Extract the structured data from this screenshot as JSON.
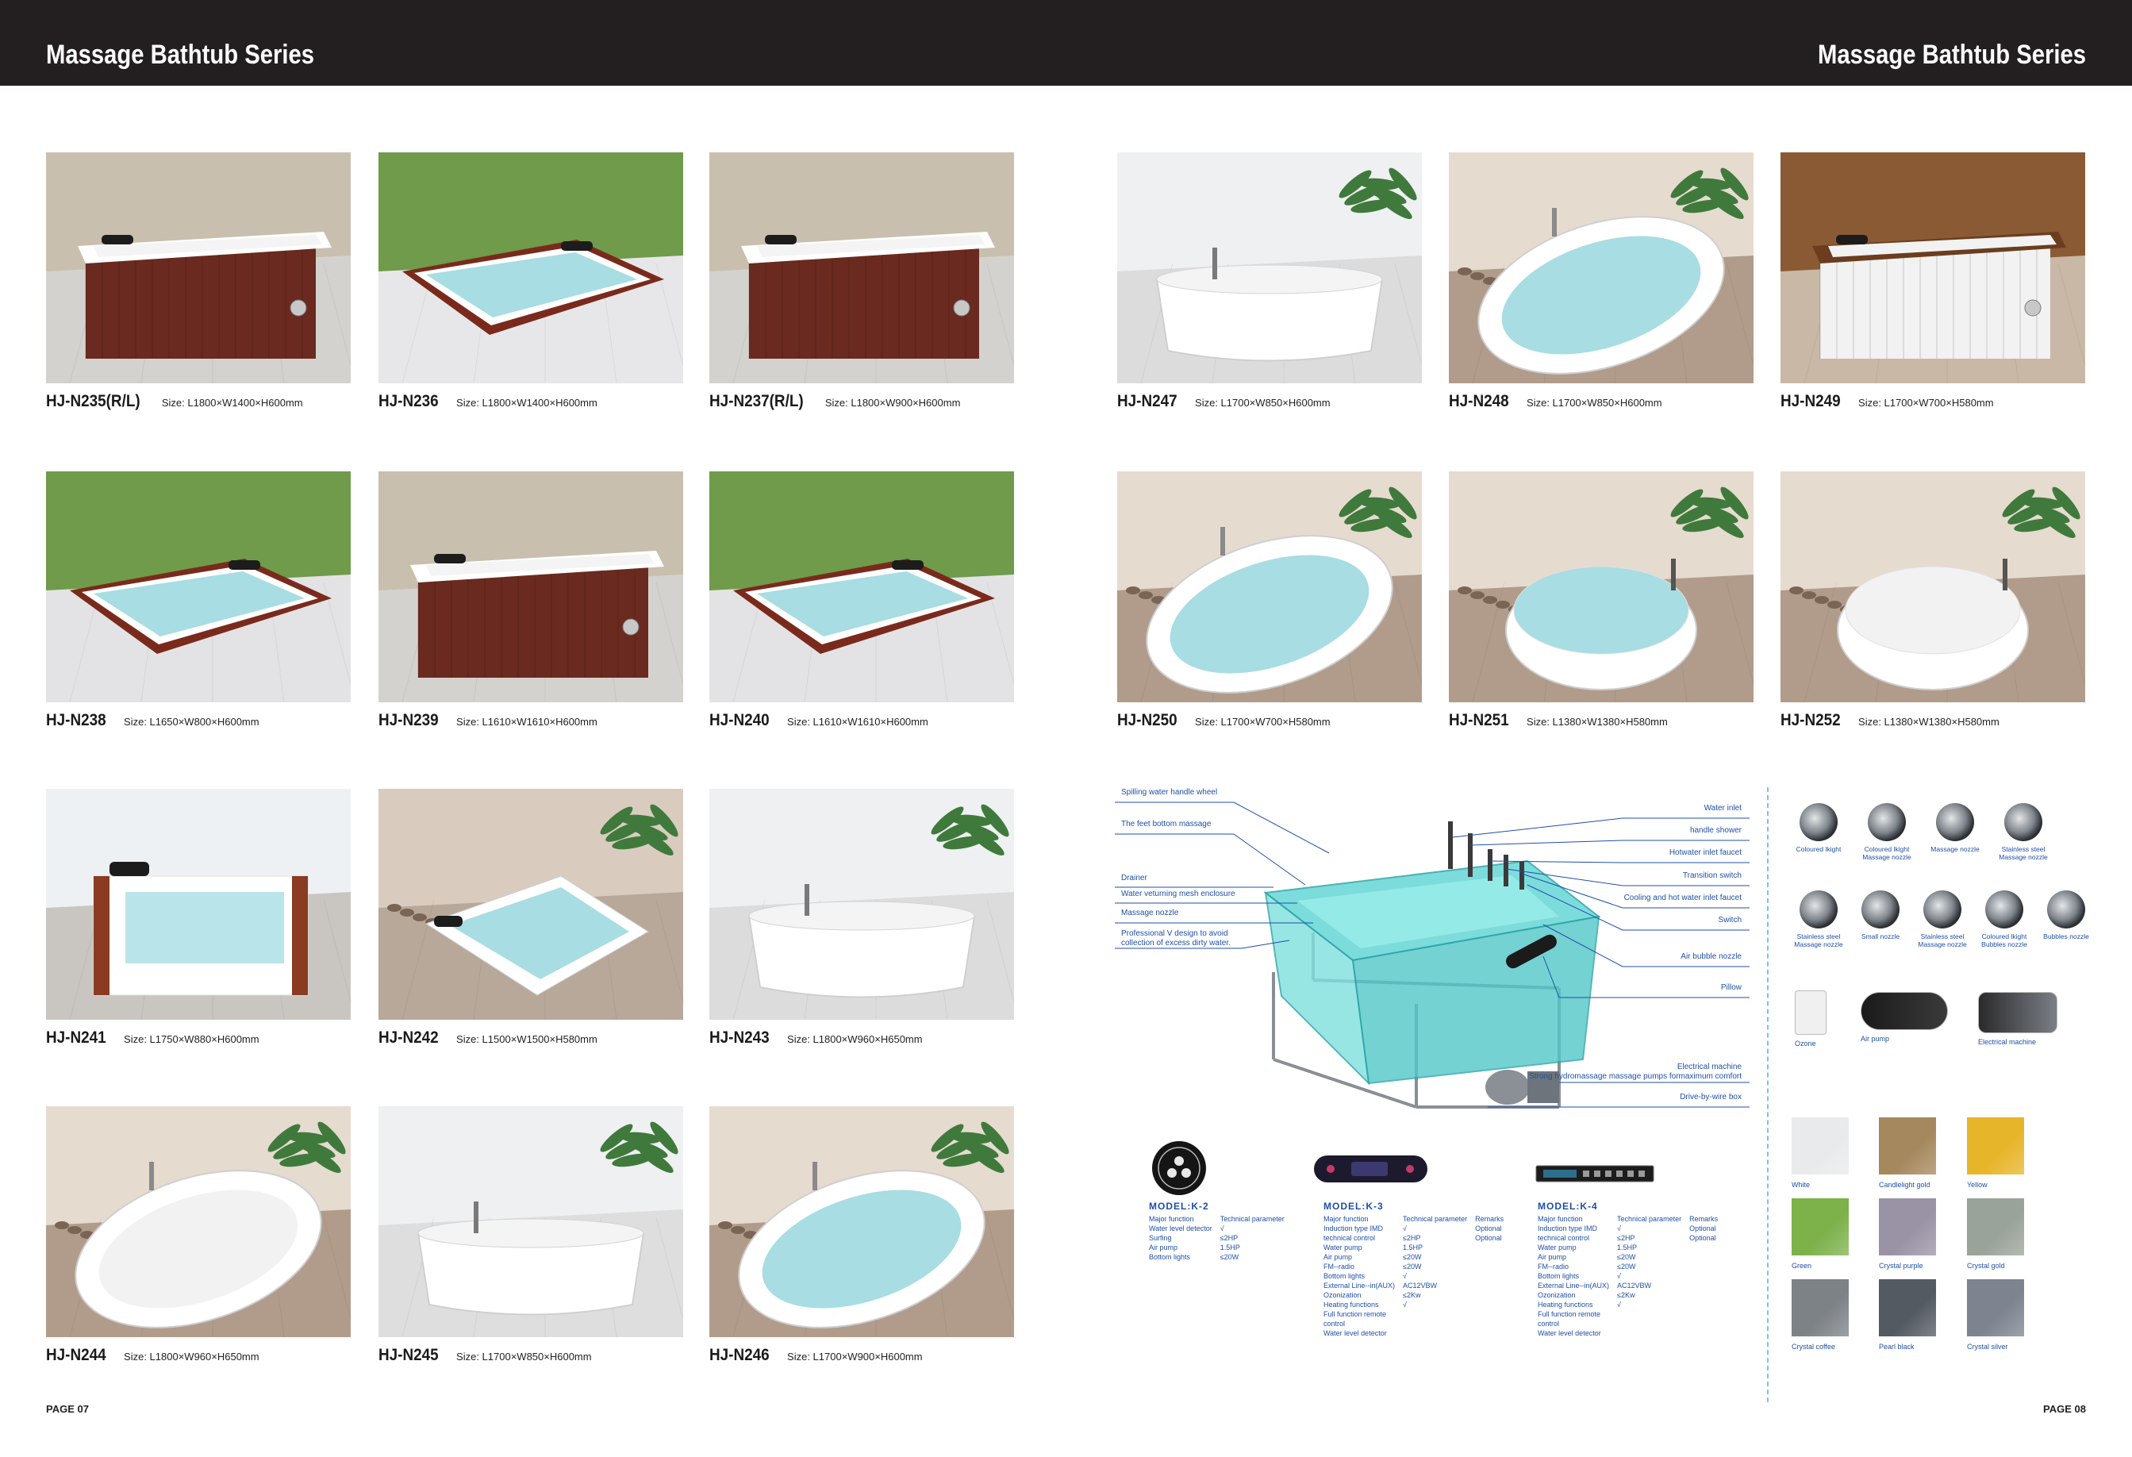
{
  "header": {
    "left_title": "Massage Bathtub Series",
    "right_title": "Massage Bathtub Series"
  },
  "size_prefix": "Size:",
  "products": [
    {
      "code": "HJ-N235(R/L)",
      "size": "Size: L1800×W1400×H600mm",
      "wall": "#c9bfae",
      "floor": "#d4d2cf",
      "tub_color": "#6b2a1f",
      "rim": "#ffffff",
      "water": "#f4f4f4",
      "style": "box"
    },
    {
      "code": "HJ-N236",
      "size": "Size: L1800×W1400×H600mm",
      "wall": "#6f9b4a",
      "floor": "#e7e7e9",
      "tub_color": "#7a2a1c",
      "rim": "#ffffff",
      "water": "#a7dde3",
      "style": "sunken"
    },
    {
      "code": "HJ-N237(R/L)",
      "size": "Size: L1800×W900×H600mm",
      "wall": "#c9bfae",
      "floor": "#d4d2cf",
      "tub_color": "#6b2a1f",
      "rim": "#ffffff",
      "water": "#f4f4f4",
      "style": "box"
    },
    {
      "code": "HJ-N238",
      "size": "Size: L1650×W800×H600mm",
      "wall": "#6f9b4a",
      "floor": "#e3e3e5",
      "tub_color": "#7a2a1c",
      "rim": "#ffffff",
      "water": "#a7dde3",
      "style": "sunken"
    },
    {
      "code": "HJ-N239",
      "size": "Size: L1610×W1610×H600mm",
      "wall": "#c9bfae",
      "floor": "#d4d2cf",
      "tub_color": "#6b2a1f",
      "rim": "#ffffff",
      "water": "#f4f4f4",
      "style": "box"
    },
    {
      "code": "HJ-N240",
      "size": "Size: L1610×W1610×H600mm",
      "wall": "#6f9b4a",
      "floor": "#e3e3e5",
      "tub_color": "#7a2a1c",
      "rim": "#ffffff",
      "water": "#a7dde3",
      "style": "sunken"
    },
    {
      "code": "HJ-N241",
      "size": "Size: L1750×W880×H600mm",
      "wall": "#eef1f3",
      "floor": "#c9c6c2",
      "tub_color": "#ffffff",
      "rim": "#8a3b22",
      "water": "#a7dde3",
      "style": "glass"
    },
    {
      "code": "HJ-N242",
      "size": "Size: L1500×W1500×H580mm",
      "wall": "#d9ccbf",
      "floor": "#b8a89a",
      "tub_color": "#ffffff",
      "rim": "#ffffff",
      "water": "#a7dde3",
      "style": "corner"
    },
    {
      "code": "HJ-N243",
      "size": "Size: L1800×W960×H650mm",
      "wall": "#eef0f1",
      "floor": "#dcdcdc",
      "tub_color": "#ffffff",
      "rim": "#ffffff",
      "water": "#ffffff",
      "style": "free"
    },
    {
      "code": "HJ-N244",
      "size": "Size: L1800×W960×H650mm",
      "wall": "#e6dbcf",
      "floor": "#b19c8b",
      "tub_color": "#ffffff",
      "rim": "#ffffff",
      "water": "#f2f2f2",
      "style": "oval"
    },
    {
      "code": "HJ-N245",
      "size": "Size: L1700×W850×H600mm",
      "wall": "#eef0f1",
      "floor": "#dedede",
      "tub_color": "#ffffff",
      "rim": "#ffffff",
      "water": "#ffffff",
      "style": "free"
    },
    {
      "code": "HJ-N246",
      "size": "Size: L1700×W900×H600mm",
      "wall": "#e6dbcf",
      "floor": "#b19c8b",
      "tub_color": "#ffffff",
      "rim": "#ffffff",
      "water": "#a7dde3",
      "style": "oval"
    },
    {
      "code": "HJ-N247",
      "size": "Size: L1700×W850×H600mm",
      "wall": "#eef0f1",
      "floor": "#dcdcdc",
      "tub_color": "#ffffff",
      "rim": "#ffffff",
      "water": "#ffffff",
      "style": "free"
    },
    {
      "code": "HJ-N248",
      "size": "Size: L1700×W850×H600mm",
      "wall": "#e6dbcf",
      "floor": "#b19c8b",
      "tub_color": "#ffffff",
      "rim": "#ffffff",
      "water": "#a7dde3",
      "style": "oval"
    },
    {
      "code": "HJ-N249",
      "size": "Size: L1700×W700×H580mm",
      "wall": "#8a5a35",
      "floor": "#c9b8a5",
      "tub_color": "#f2f2f2",
      "rim": "#6b3d1e",
      "water": "#f2f2f2",
      "style": "box"
    },
    {
      "code": "HJ-N250",
      "size": "Size: L1700×W700×H580mm",
      "wall": "#e6dbcf",
      "floor": "#b19c8b",
      "tub_color": "#ffffff",
      "rim": "#ffffff",
      "water": "#a7dde3",
      "style": "oval"
    },
    {
      "code": "HJ-N251",
      "size": "Size: L1380×W1380×H580mm",
      "wall": "#e6dbcf",
      "floor": "#b19c8b",
      "tub_color": "#ffffff",
      "rim": "#ffffff",
      "water": "#a7dde3",
      "style": "round"
    },
    {
      "code": "HJ-N252",
      "size": "Size: L1380×W1380×H580mm",
      "wall": "#e6dbcf",
      "floor": "#b19c8b",
      "tub_color": "#ffffff",
      "rim": "#ffffff",
      "water": "#f2f2f2",
      "style": "round"
    }
  ],
  "diagram": {
    "left_labels": [
      "Spilling water handle wheel",
      "The feet bottom massage",
      "Drainer",
      "Water veturning mesh enclosure",
      "Massage nozzle",
      "Professional V design to avoid",
      "collection of excess dirty water."
    ],
    "right_labels": [
      "Water inlet",
      "handle shower",
      "Hotwater inlet faucet",
      "Transition switch",
      "Cooling and hot water inlet faucet",
      "Switch",
      "Air bubble nozzle",
      "Pillow",
      "Electrical machine",
      "Strong hydromassage massage pumps formaximum comfort",
      "Drive-by-wire box"
    ]
  },
  "models": [
    {
      "title": "MODEL:K-2",
      "col1": [
        "Major function",
        "Water level detector",
        "Surfing",
        "Air pump",
        "Bottom lights"
      ],
      "col2": [
        "Technical parameter",
        "√",
        "≤2HP",
        "1.5HP",
        "≤20W"
      ],
      "col3": []
    },
    {
      "title": "MODEL:K-3",
      "col1": [
        "Major function",
        "Induction type IMD",
        "technical control",
        "Water pump",
        "Air pump",
        "FM--radio",
        "Bottom lights",
        "External Line--in(AUX)",
        "Ozonization",
        "Heating functions",
        "Full function remote",
        "control",
        "Water level detector"
      ],
      "col2": [
        "Technical parameter",
        "√",
        "≤2HP",
        "1.5HP",
        "≤20W",
        "≤20W",
        "√",
        "AC12VBW",
        "≤2Kw",
        "√"
      ],
      "col3": [
        "Remarks",
        "Optional",
        "Optional"
      ]
    },
    {
      "title": "MODEL:K-4",
      "col1": [
        "Major function",
        "Induction type IMD",
        "technical control",
        "Water pump",
        "Air pump",
        "FM--radio",
        "Bottom lights",
        "External Line--in(AUX)",
        "Ozonization",
        "Heating functions",
        "Full function remote",
        "control",
        "Water level detector"
      ],
      "col2": [
        "Technical parameter",
        "√",
        "≤2HP",
        "1.5HP",
        "≤20W",
        "≤20W",
        "√",
        "AC12VBW",
        "≤2Kw",
        "√"
      ],
      "col3": [
        "Remarks",
        "Optional",
        "Optional"
      ]
    }
  ],
  "parts_row1": [
    {
      "label": "Coloured lkight",
      "icon": "nozzle-icon"
    },
    {
      "label": "Coloured lkight Massage nozzle",
      "icon": "nozzle-icon"
    },
    {
      "label": "Massage nozzle",
      "icon": "nozzle-icon"
    },
    {
      "label": "Stainless steel Massage nozzle",
      "icon": "nozzle-icon"
    }
  ],
  "parts_row2": [
    {
      "label": "Stainless steel Massage nozzle",
      "icon": "nozzle-icon"
    },
    {
      "label": "Small nozzle",
      "icon": "nozzle-icon"
    },
    {
      "label": "Stainless steel Massage nozzle",
      "icon": "nozzle-icon"
    },
    {
      "label": "Coloured lkight Bubbles nozzle",
      "icon": "nozzle-icon"
    },
    {
      "label": "Bubbles nozzle",
      "icon": "nozzle-icon"
    }
  ],
  "equipment": [
    {
      "label": "Ozone",
      "icon": "ozone-icon"
    },
    {
      "label": "Air pump",
      "icon": "air-pump-icon"
    },
    {
      "label": "Electrical machine",
      "icon": "motor-icon"
    }
  ],
  "swatches": [
    {
      "label": "White",
      "color": "#e9eaec"
    },
    {
      "label": "Candlelight gold",
      "color": "#a6885e"
    },
    {
      "label": "Yellow",
      "color": "#e7b52a"
    },
    {
      "label": "Green",
      "color": "#7db14a"
    },
    {
      "label": "Crystal purple",
      "color": "#9a93a6"
    },
    {
      "label": "Crystal gold",
      "color": "#9aa39a"
    },
    {
      "label": "Crystal coffee",
      "color": "#7d8287"
    },
    {
      "label": "Pearl black",
      "color": "#545a62"
    },
    {
      "label": "Crystal silver",
      "color": "#7d8490"
    }
  ],
  "pages": {
    "left": "PAGE 07",
    "right": "PAGE 08"
  }
}
